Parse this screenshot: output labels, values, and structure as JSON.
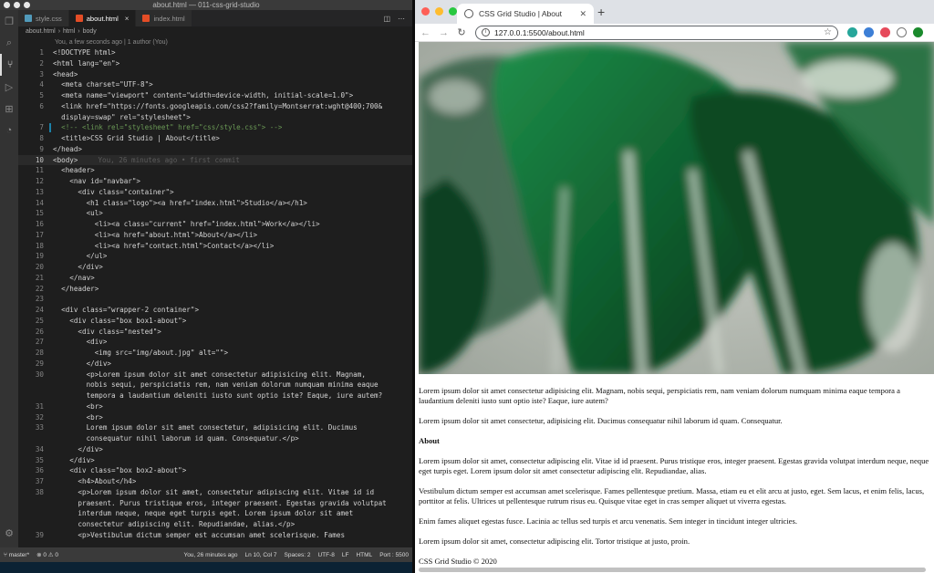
{
  "vscode": {
    "window_title": "about.html — 011-css-grid-studio",
    "tabs": [
      {
        "label": "style.css",
        "color": "#519aba",
        "active": false
      },
      {
        "label": "about.html",
        "color": "#e44d26",
        "active": true
      },
      {
        "label": "index.html",
        "color": "#e44d26",
        "active": false
      }
    ],
    "breadcrumb": [
      "about.html",
      "html",
      "body"
    ],
    "blame": "You, a few seconds ago | 1 author (You)",
    "ghost_blame": "You, 26 minutes ago • first commit",
    "lines": [
      {
        "n": "1",
        "text": "<!DOCTYPE html>"
      },
      {
        "n": "2",
        "text": "<html lang=\"en\">"
      },
      {
        "n": "3",
        "text": "<head>"
      },
      {
        "n": "4",
        "text": "  <meta charset=\"UTF-8\">"
      },
      {
        "n": "5",
        "text": "  <meta name=\"viewport\" content=\"width=device-width, initial-scale=1.0\">"
      },
      {
        "n": "6",
        "text": "  <link href=\"https://fonts.googleapis.com/css2?family=Montserrat:wght@400;700&"
      },
      {
        "n": "",
        "text": "  display=swap\" rel=\"stylesheet\">"
      },
      {
        "n": "7",
        "text": "  <!-- <link rel=\"stylesheet\" href=\"css/style.css\"> -->"
      },
      {
        "n": "8",
        "text": "  <title>CSS Grid Studio | About</title>"
      },
      {
        "n": "9",
        "text": "</head>"
      },
      {
        "n": "10",
        "text": "<body>"
      },
      {
        "n": "11",
        "text": "  <header>"
      },
      {
        "n": "12",
        "text": "    <nav id=\"navbar\">"
      },
      {
        "n": "13",
        "text": "      <div class=\"container\">"
      },
      {
        "n": "14",
        "text": "        <h1 class=\"logo\"><a href=\"index.html\">Studio</a></h1>"
      },
      {
        "n": "15",
        "text": "        <ul>"
      },
      {
        "n": "16",
        "text": "          <li><a class=\"current\" href=\"index.html\">Work</a></li>"
      },
      {
        "n": "17",
        "text": "          <li><a href=\"about.html\">About</a></li>"
      },
      {
        "n": "18",
        "text": "          <li><a href=\"contact.html\">Contact</a></li>"
      },
      {
        "n": "19",
        "text": "        </ul>"
      },
      {
        "n": "20",
        "text": "      </div>"
      },
      {
        "n": "21",
        "text": "    </nav>"
      },
      {
        "n": "22",
        "text": "  </header>"
      },
      {
        "n": "23",
        "text": ""
      },
      {
        "n": "24",
        "text": "  <div class=\"wrapper-2 container\">"
      },
      {
        "n": "25",
        "text": "    <div class=\"box box1-about\">"
      },
      {
        "n": "26",
        "text": "      <div class=\"nested\">"
      },
      {
        "n": "27",
        "text": "        <div>"
      },
      {
        "n": "28",
        "text": "          <img src=\"img/about.jpg\" alt=\"\">"
      },
      {
        "n": "29",
        "text": "        </div>"
      },
      {
        "n": "30",
        "text": "        <p>Lorem ipsum dolor sit amet consectetur adipisicing elit. Magnam,"
      },
      {
        "n": "",
        "text": "        nobis sequi, perspiciatis rem, nam veniam dolorum numquam minima eaque"
      },
      {
        "n": "",
        "text": "        tempora a laudantium deleniti iusto sunt optio iste? Eaque, iure autem?"
      },
      {
        "n": "31",
        "text": "        <br>"
      },
      {
        "n": "32",
        "text": "        <br>"
      },
      {
        "n": "33",
        "text": "        Lorem ipsum dolor sit amet consectetur, adipisicing elit. Ducimus"
      },
      {
        "n": "",
        "text": "        consequatur nihil laborum id quam. Consequatur.</p>"
      },
      {
        "n": "34",
        "text": "      </div>"
      },
      {
        "n": "35",
        "text": "    </div>"
      },
      {
        "n": "36",
        "text": "    <div class=\"box box2-about\">"
      },
      {
        "n": "37",
        "text": "      <h4>About</h4>"
      },
      {
        "n": "38",
        "text": "      <p>Lorem ipsum dolor sit amet, consectetur adipiscing elit. Vitae id id"
      },
      {
        "n": "",
        "text": "      praesent. Purus tristique eros, integer praesent. Egestas gravida volutpat"
      },
      {
        "n": "",
        "text": "      interdum neque, neque eget turpis eget. Lorem ipsum dolor sit amet"
      },
      {
        "n": "",
        "text": "      consectetur adipiscing elit. Repudiandae, alias.</p>"
      },
      {
        "n": "39",
        "text": "      <p>Vestibulum dictum semper est accumsan amet scelerisque. Fames"
      }
    ],
    "status": {
      "branch": "master*",
      "problems": "⊗ 0 ⚠ 0",
      "blame": "You, 26 minutes ago",
      "position": "Ln 10, Col 7",
      "spaces": "Spaces: 2",
      "encoding": "UTF-8",
      "eol": "LF",
      "language": "HTML",
      "port": "Port : 5500"
    }
  },
  "chrome": {
    "tab_title": "CSS Grid Studio | About",
    "url": "127.0.0.1:5500/about.html",
    "page": {
      "p1": "Lorem ipsum dolor sit amet consectetur adipisicing elit. Magnam, nobis sequi, perspiciatis rem, nam veniam dolorum numquam minima eaque tempora a laudantium deleniti iusto sunt optio iste? Eaque, iure autem?",
      "p2": "Lorem ipsum dolor sit amet consectetur, adipisicing elit. Ducimus consequatur nihil laborum id quam. Consequatur.",
      "heading": "About",
      "p3": "Lorem ipsum dolor sit amet, consectetur adipiscing elit. Vitae id id praesent. Purus tristique eros, integer praesent. Egestas gravida volutpat interdum neque, neque eget turpis eget. Lorem ipsum dolor sit amet consectetur adipiscing elit. Repudiandae, alias.",
      "p4": "Vestibulum dictum semper est accumsan amet scelerisque. Fames pellentesque pretium. Massa, etiam eu et elit arcu at justo, eget. Sem lacus, et enim felis, lacus, porttitor at felis. Ultrices ut pellentesque rutrum risus eu. Quisque vitae eget in cras semper aliquet ut viverra egestas.",
      "p5": "Enim fames aliquet egestas fusce. Lacinia ac tellus sed turpis et arcu venenatis. Sem integer in tincidunt integer ultricies.",
      "p6": "Lorem ipsum dolor sit amet, consectetur adipiscing elit. Tortor tristique at justo, proin.",
      "footer": "CSS Grid Studio © 2020"
    }
  }
}
